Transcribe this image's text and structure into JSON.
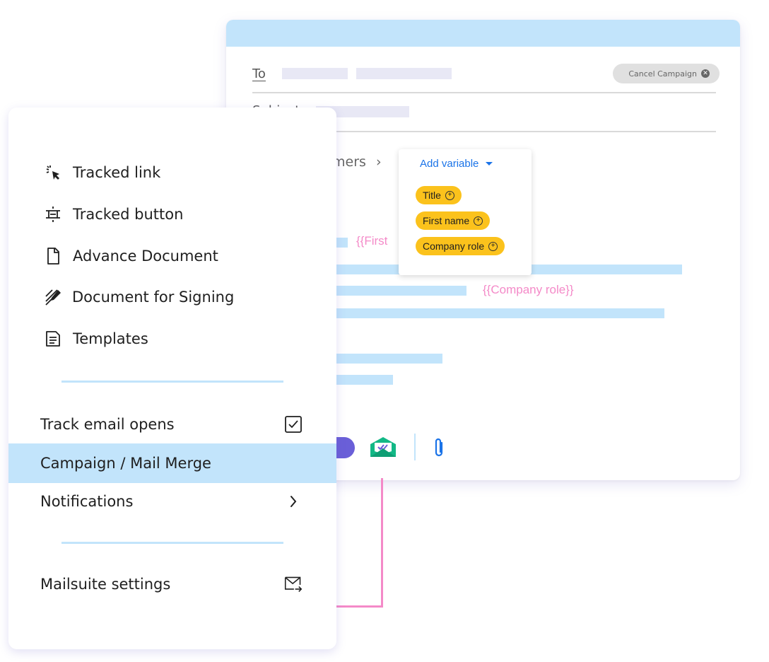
{
  "compose": {
    "to_label": "To",
    "subject_label": "Subject",
    "cancel_label": "Cancel Campaign",
    "breadcrumb": "mers",
    "var_first": "{{First",
    "var_company_role": "{{Company role}}"
  },
  "variable_menu": {
    "title": "Add variable",
    "chips": [
      "Title",
      "First name",
      "Company role"
    ]
  },
  "side_menu": {
    "items": [
      {
        "label": "Tracked link",
        "icon": "cursor-click-icon"
      },
      {
        "label": "Tracked button",
        "icon": "button-icon"
      },
      {
        "label": "Advance Document",
        "icon": "document-icon"
      },
      {
        "label": "Document for Signing",
        "icon": "pen-signature-icon"
      },
      {
        "label": "Templates",
        "icon": "template-icon"
      }
    ],
    "track_opens": "Track email opens",
    "campaign": "Campaign / Mail Merge",
    "notifications": "Notifications",
    "settings": "Mailsuite settings"
  },
  "colors": {
    "accent_blue": "#c2e4fb",
    "chip_yellow": "#fbc21c",
    "variable_pink": "#f48ac8",
    "link_blue": "#1a73e8"
  }
}
